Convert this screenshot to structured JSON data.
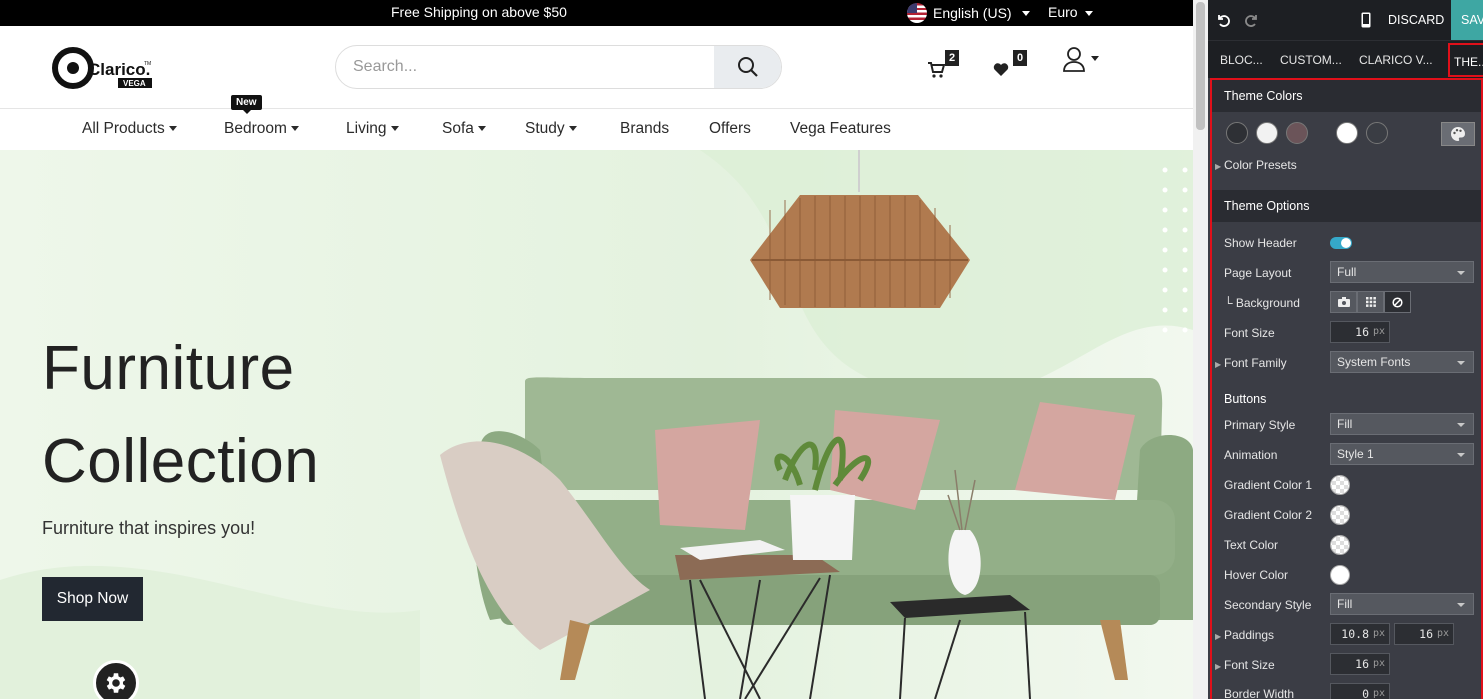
{
  "topbar": {
    "shipping_text": "Free Shipping on above $50",
    "language": "English (US)",
    "currency": "Euro"
  },
  "header": {
    "logo_text": "Clarico.",
    "logo_sub": "VEGA",
    "logo_tm": "TM",
    "search_placeholder": "Search...",
    "cart_count": "2",
    "wishlist_count": "0"
  },
  "nav": {
    "new_tag": "New",
    "items": [
      "All Products",
      "Bedroom",
      "Living",
      "Sofa",
      "Study",
      "Brands",
      "Offers",
      "Vega Features"
    ]
  },
  "hero": {
    "title_line1": "Furniture",
    "title_line2": "Collection",
    "subtitle": "Furniture that inspires you!",
    "cta": "Shop Now"
  },
  "panel": {
    "discard_label": "DISCARD",
    "save_label": "SAV",
    "tabs": [
      "BLOC...",
      "CUSTOM...",
      "CLARICO V...",
      "THE..."
    ],
    "theme_colors_title": "Theme Colors",
    "swatch_colors": [
      "#2e3035",
      "#f2f2f2",
      "#6b5459",
      "#ffffff",
      "#3a3d44"
    ],
    "color_presets_label": "Color Presets",
    "theme_options_title": "Theme Options",
    "show_header_label": "Show Header",
    "page_layout_label": "Page Layout",
    "page_layout_value": "Full",
    "background_label": "└ Background",
    "font_size_label": "Font Size",
    "font_size_value": "16",
    "unit_px": "px",
    "font_family_label": "Font Family",
    "font_family_value": "System Fonts",
    "buttons_title": "Buttons",
    "primary_style_label": "Primary Style",
    "primary_style_value": "Fill",
    "animation_label": "Animation",
    "animation_value": "Style 1",
    "gradient1_label": "Gradient Color 1",
    "gradient2_label": "Gradient Color 2",
    "text_color_label": "Text Color",
    "hover_color_label": "Hover Color",
    "secondary_style_label": "Secondary Style",
    "secondary_style_value": "Fill",
    "paddings_label": "Paddings",
    "padding_y_value": "10.8",
    "padding_x_value": "16",
    "btn_font_size_label": "Font Size",
    "btn_font_size_value": "16",
    "border_width_label": "Border Width",
    "border_width_value": "0"
  }
}
